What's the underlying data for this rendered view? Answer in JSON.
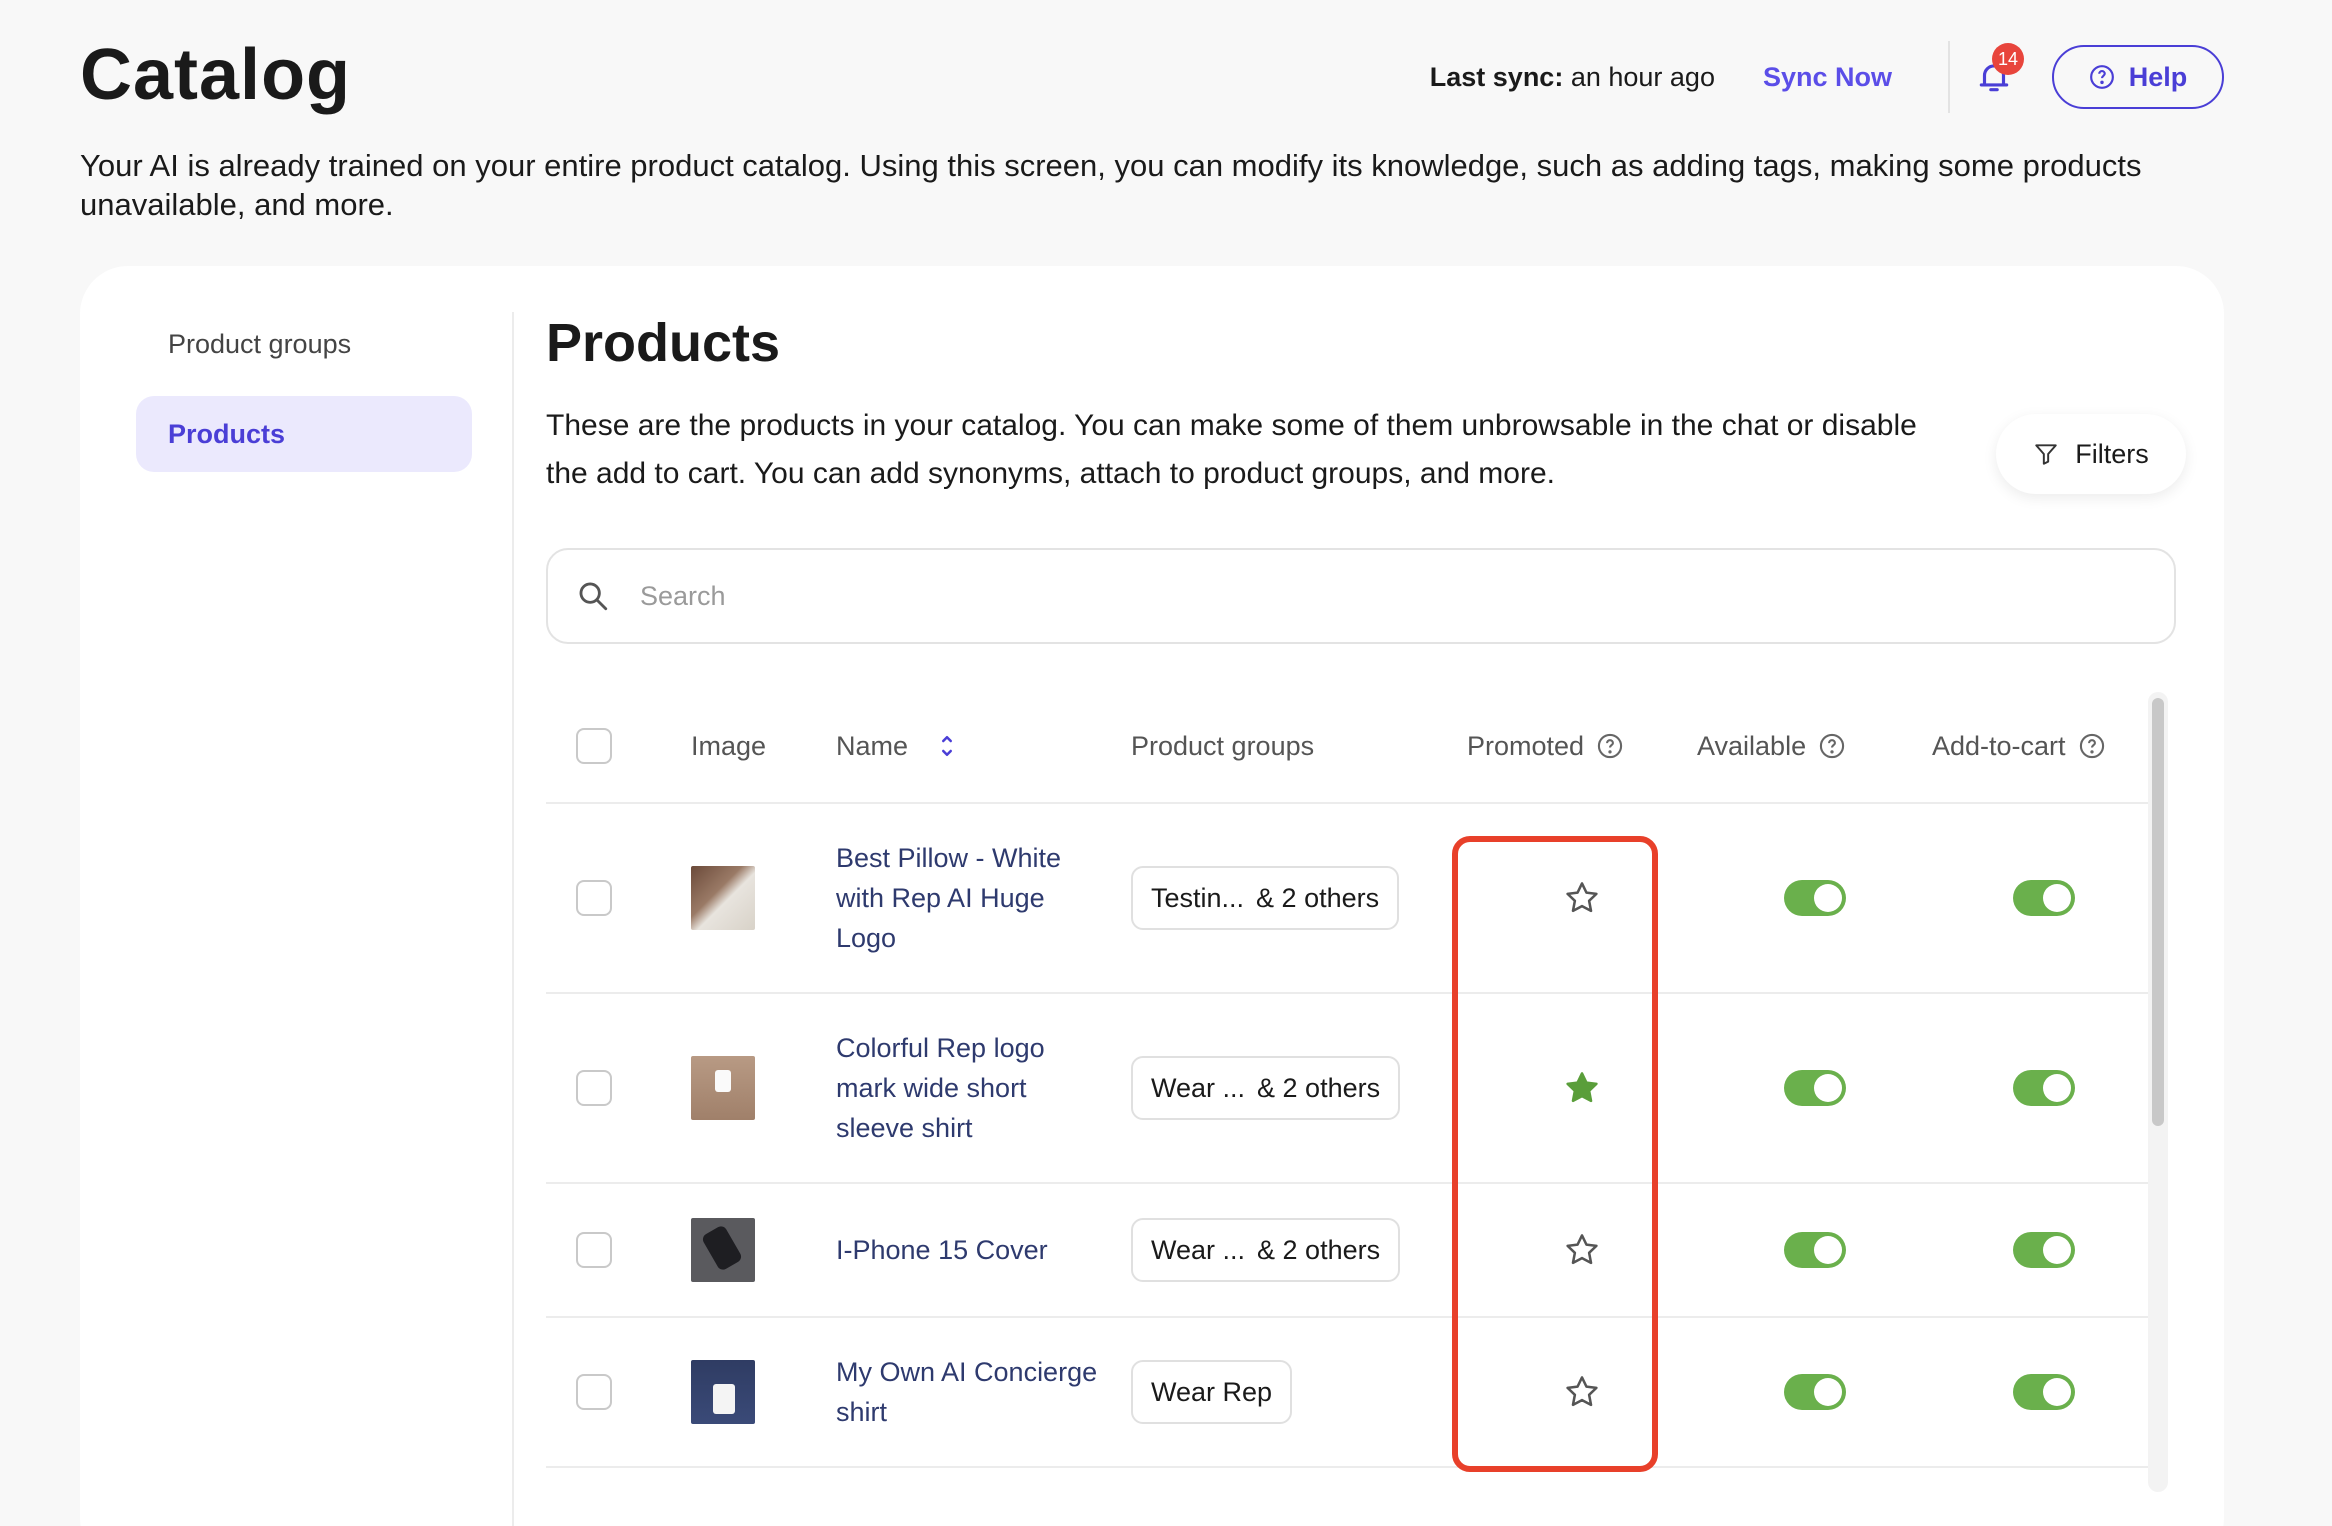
{
  "header": {
    "title": "Catalog",
    "last_sync_label": "Last sync:",
    "last_sync_value": "an hour ago",
    "sync_now_label": "Sync Now",
    "notifications_count": "14",
    "help_label": "Help"
  },
  "intro_text": "Your AI is already trained on your entire product catalog. Using this screen, you can modify its knowledge, such as adding tags, making some products unavailable, and more.",
  "sidebar": {
    "items": [
      {
        "label": "Product groups",
        "active": false
      },
      {
        "label": "Products",
        "active": true
      }
    ]
  },
  "main": {
    "title": "Products",
    "description": "These are the products in your catalog. You can make some of them unbrowsable in the chat or disable the add to cart. You can add synonyms, attach to product groups, and more.",
    "filters_label": "Filters",
    "search_placeholder": "Search"
  },
  "table": {
    "columns": {
      "image": "Image",
      "name": "Name",
      "groups": "Product groups",
      "promoted": "Promoted",
      "available": "Available",
      "cart": "Add-to-cart"
    },
    "rows": [
      {
        "name": "Best Pillow - White with Rep AI Huge Logo",
        "group": "Testin...",
        "others": "& 2 others",
        "promoted": false,
        "available": true,
        "add_to_cart": true
      },
      {
        "name": "Colorful Rep logo mark wide short sleeve shirt",
        "group": "Wear ...",
        "others": "& 2 others",
        "promoted": true,
        "available": true,
        "add_to_cart": true
      },
      {
        "name": "I-Phone 15 Cover",
        "group": "Wear ...",
        "others": "& 2 others",
        "promoted": false,
        "available": true,
        "add_to_cart": true
      },
      {
        "name": "My Own AI Concierge shirt",
        "group": "Wear Rep",
        "others": "",
        "promoted": false,
        "available": true,
        "add_to_cart": true
      }
    ]
  },
  "colors": {
    "accent": "#4a3ed6",
    "toggle_on": "#6ab04c",
    "star_promoted": "#5a9e3a",
    "highlight": "#e8402a"
  }
}
